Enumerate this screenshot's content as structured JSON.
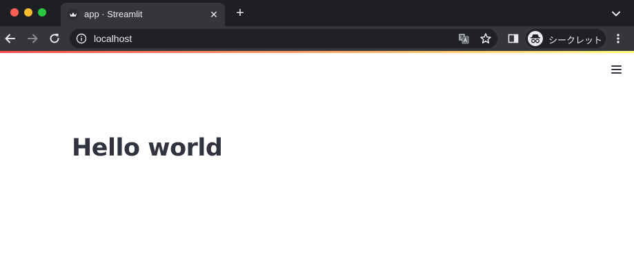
{
  "browser": {
    "tab": {
      "title": "app · Streamlit",
      "close_glyph": "✕",
      "favicon": "streamlit-crown-icon"
    },
    "new_tab_glyph": "+",
    "address_bar": {
      "url": "localhost"
    },
    "profile": {
      "label": "シークレット",
      "icon": "incognito-icon"
    },
    "colors": {
      "tab_strip": "#1e1f22",
      "toolbar": "#35363a",
      "omnibox": "#202124",
      "text": "#e8eaed"
    }
  },
  "app": {
    "title": "Hello world",
    "menu_icon": "hamburger-menu-icon",
    "colors": {
      "text": "#31333f",
      "decoration_start": "#ff4b4b",
      "decoration_end": "#fffd80",
      "background": "#ffffff"
    }
  }
}
